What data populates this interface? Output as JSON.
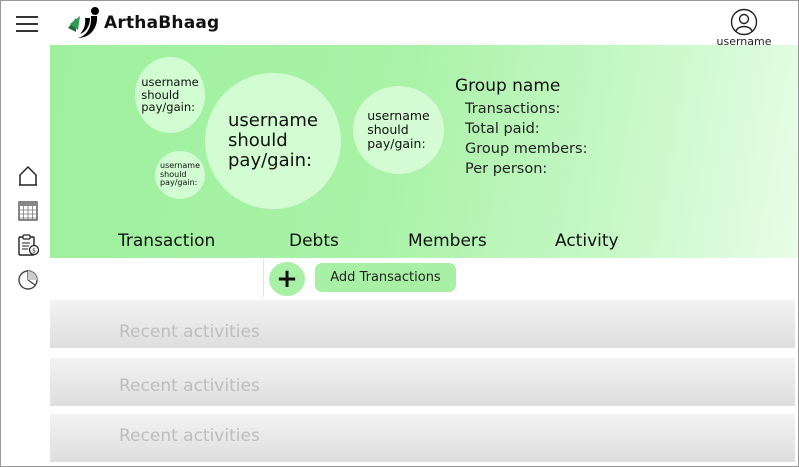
{
  "header": {
    "app_name": "ArthaBhaag",
    "user_label": "username",
    "menu_icon": "hamburger-menu-icon",
    "avatar_icon": "user-avatar-icon"
  },
  "sidebar": {
    "items": [
      {
        "icon": "home-icon"
      },
      {
        "icon": "calendar-icon"
      },
      {
        "icon": "clipboard-money-icon"
      },
      {
        "icon": "pie-chart-icon"
      }
    ]
  },
  "bubbles": {
    "top_left": [
      "username",
      "should",
      "pay/gain:"
    ],
    "small": [
      "username",
      "should",
      "pay/gain:"
    ],
    "large": [
      "username",
      "should",
      "pay/gain:"
    ],
    "right": [
      "username",
      "should",
      "pay/gain:"
    ]
  },
  "group": {
    "name": "Group name",
    "transactions_label": "Transactions:",
    "total_paid_label": "Total paid:",
    "members_label": "Group members:",
    "per_person_label": "Per person:"
  },
  "tabs": [
    "Transaction",
    "Debts",
    "Members",
    "Activity"
  ],
  "toolbar": {
    "plus_symbol": "+",
    "add_label": "Add Transactions"
  },
  "activities": [
    "Recent activities",
    "Recent activities",
    "Recent activities"
  ],
  "colors": {
    "accent_green": "#a8f0a6",
    "hero_start": "#9ef09e",
    "hero_end": "#e8fde8",
    "placeholder_text": "#bdbdbd"
  }
}
